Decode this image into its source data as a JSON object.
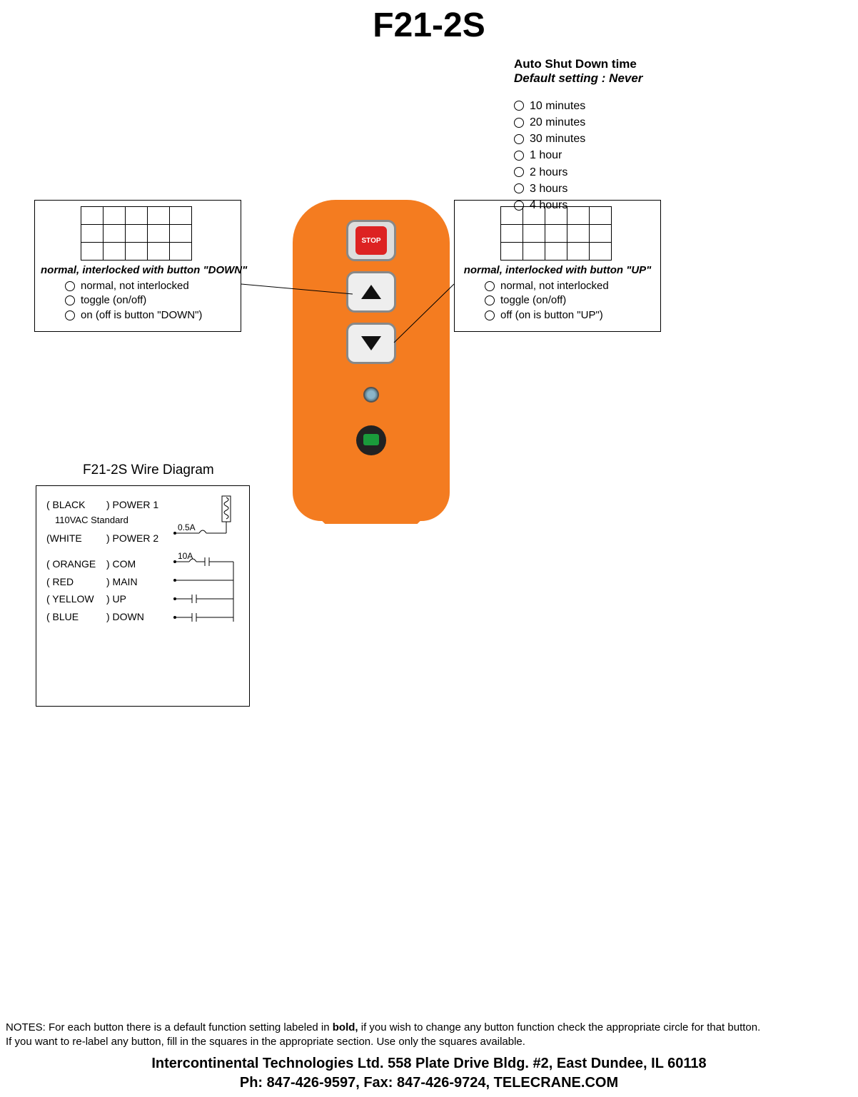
{
  "title": "F21-2S",
  "auto_shutdown": {
    "heading": "Auto Shut Down time",
    "subheading": "Default setting : Never",
    "options": [
      "10 minutes",
      "20 minutes",
      "30 minutes",
      "1 hour",
      "2 hours",
      "3 hours",
      "4 hours"
    ]
  },
  "left_block": {
    "heading": "normal, interlocked with button \"DOWN\"",
    "options": [
      "normal, not interlocked",
      "toggle (on/off)",
      "on (off is button \"DOWN\")"
    ]
  },
  "right_block": {
    "heading": "normal, interlocked with button \"UP\"",
    "options": [
      "normal, not interlocked",
      "toggle (on/off)",
      "off (on is button \"UP\")"
    ]
  },
  "remote": {
    "stop_label": "STOP"
  },
  "wire": {
    "title": "F21-2S   Wire Diagram",
    "rows": [
      {
        "c1": "( BLACK",
        "c2": ") POWER 1"
      },
      {
        "sub": "110VAC Standard"
      },
      {
        "c1": "(WHITE",
        "c2": ") POWER 2"
      },
      {
        "spacer": true
      },
      {
        "c1": "( ORANGE",
        "c2": ") COM"
      },
      {
        "c1": "( RED",
        "c2": ") MAIN"
      },
      {
        "c1": "( YELLOW",
        "c2": ") UP"
      },
      {
        "c1": "( BLUE",
        "c2": ") DOWN"
      }
    ],
    "fuse1": "0.5A",
    "fuse2": "10A"
  },
  "notes": {
    "prefix": "NOTES: For each button there is a default function setting labeled in ",
    "bold": "bold,",
    "rest1": " if you wish to change any button function check the appropriate circle for that button.",
    "line2": "If you want to re-label any button, fill in the squares in the appropriate section. Use only the squares available.",
    "addr": "Intercontinental Technologies Ltd. 558 Plate Drive Bldg. #2, East Dundee, IL  60118",
    "contact": "Ph: 847-426-9597, Fax: 847-426-9724, TELECRANE.COM"
  }
}
